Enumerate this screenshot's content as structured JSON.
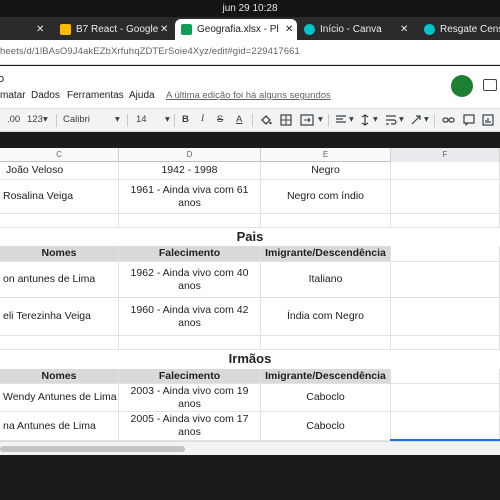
{
  "system": {
    "clock": "jun 29  10:28"
  },
  "tabs": [
    {
      "label": "",
      "close": "✕",
      "icon": "tab-icon",
      "icon_color": "#5f6368"
    },
    {
      "label": "B7 React - Google",
      "close": "✕",
      "icon": "google-drive-icon",
      "icon_color": "#fbbc04"
    },
    {
      "label": "Geografia.xlsx - Pl",
      "close": "✕",
      "icon": "google-sheets-icon",
      "icon_color": "#0f9d58",
      "active": true
    },
    {
      "label": "Início - Canva",
      "close": "✕",
      "icon": "canva-icon",
      "icon_color": "#00c4cc"
    },
    {
      "label": "Resgate Censi",
      "close": "",
      "icon": "canva-icon",
      "icon_color": "#00c4cc"
    }
  ],
  "address": {
    "url": "heets/d/1lBAsO9J4akEZbXrfuhqZDTErSoie4Xyz/edit#gid=229417661"
  },
  "doc": {
    "title": "o",
    "menus": [
      "matar",
      "Dados",
      "Ferramentas",
      "Ajuda"
    ],
    "last_edit": "A última edição foi há alguns segundos",
    "avatar_color": "#1e7e34"
  },
  "toolbar": {
    "decimal": ".00",
    "format": "123",
    "font": "Calibri",
    "size": "14",
    "bold": "B",
    "italic": "I",
    "strike": "S",
    "textcolor": "A",
    "chevron": "▾"
  },
  "columns": [
    "C",
    "D",
    "E",
    "F"
  ],
  "rows": {
    "r1": [
      "João Veloso",
      "1942 - 1998",
      "Negro"
    ],
    "r2": [
      "Rosalina Veiga",
      "1961 - Ainda viva com 61 anos",
      "Negro com índio"
    ],
    "pais_title": "Pais",
    "pais_hdr": [
      "Nomes",
      "Falecimento",
      "Imigrante/Descendência"
    ],
    "p1": [
      "on antunes de Lima",
      "1962 - Ainda vivo com 40 anos",
      "Italiano"
    ],
    "p2": [
      "eli Terezinha Veiga",
      "1960 - Ainda viva com 42 anos",
      "Índia com Negro"
    ],
    "irmaos_title": "Irmãos",
    "irmaos_hdr": [
      "Nomes",
      "Falecimento",
      "Imigrante/Descendência"
    ],
    "i1": [
      "Wendy Antunes de Lima",
      "2003 - Ainda vivo com 19 anos",
      "Caboclo"
    ],
    "i2": [
      "na Antunes de Lima",
      "2005 - Ainda vivo com 17 anos",
      "Caboclo"
    ]
  }
}
